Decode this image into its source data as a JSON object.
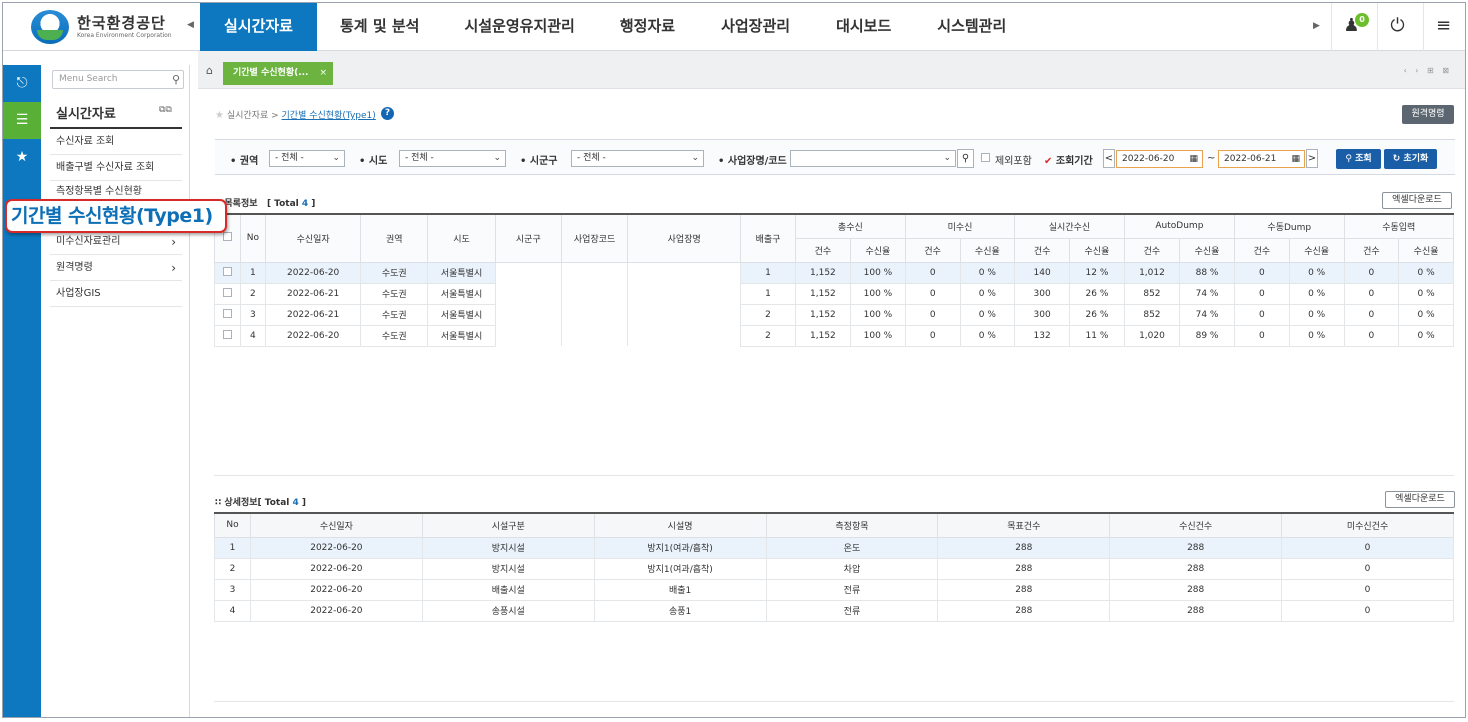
{
  "logo": {
    "title": "한국환경공단",
    "subtitle": "Korea Environment Corporation"
  },
  "gnb": [
    "실시간자료",
    "통계 및 분석",
    "시설운영유지관리",
    "행정자료",
    "사업장관리",
    "대시보드",
    "시스템관리"
  ],
  "topbar": {
    "badge": "0"
  },
  "left_icons": [
    "back-icon",
    "list-icon",
    "star-icon"
  ],
  "menu": {
    "search_placeholder": "Menu Search",
    "title": "실시간자료",
    "items": [
      "수신자료 조회",
      "배출구별 수신자료 조회",
      "측정항목별 수신현황",
      "",
      "미수신자료관리",
      "원격명령",
      "사업장GIS"
    ]
  },
  "callout": "기간별 수신현황(Type1)",
  "tab": {
    "label": "기간별 수신현황(...",
    "close": "×"
  },
  "breadcrumb": {
    "root": "실시간자료 >",
    "current": "기간별 수신현황(Type1)"
  },
  "remote_button": "원격명령",
  "filters": {
    "region_label": "권역",
    "region_value": "- 전체 -",
    "sido_label": "시도",
    "sido_value": "- 전체 -",
    "sigungu_label": "시군구",
    "sigungu_value": "- 전체 -",
    "site_label": "사업장명/코드",
    "site_value": "",
    "exclude_label": "제외포함",
    "period_label": "조회기간",
    "date_from": "2022-06-20",
    "date_sep": "~",
    "date_to": "2022-06-21",
    "search_btn": "조회",
    "reset_btn": "초기화"
  },
  "list": {
    "title": "목록정보",
    "total_label": "[ Total ",
    "total": "4",
    "total_end": " ]",
    "excel": "엑셀다운로드",
    "headers": [
      "No",
      "수신일자",
      "권역",
      "시도",
      "시군구",
      "사업장코드",
      "사업장명",
      "배출구"
    ],
    "group_headers": [
      "총수신",
      "미수신",
      "실시간수신",
      "AutoDump",
      "수동Dump",
      "수동입력"
    ],
    "sub_headers": [
      "건수",
      "수신율"
    ],
    "rows": [
      [
        "1",
        "2022-06-20",
        "수도권",
        "서울특별시",
        "",
        "",
        "",
        "1",
        "1,152",
        "100 %",
        "0",
        "0 %",
        "140",
        "12 %",
        "1,012",
        "88 %",
        "0",
        "0 %",
        "0",
        "0 %"
      ],
      [
        "2",
        "2022-06-21",
        "수도권",
        "서울특별시",
        "",
        "",
        "",
        "1",
        "1,152",
        "100 %",
        "0",
        "0 %",
        "300",
        "26 %",
        "852",
        "74 %",
        "0",
        "0 %",
        "0",
        "0 %"
      ],
      [
        "3",
        "2022-06-21",
        "수도권",
        "서울특별시",
        "",
        "",
        "",
        "2",
        "1,152",
        "100 %",
        "0",
        "0 %",
        "300",
        "26 %",
        "852",
        "74 %",
        "0",
        "0 %",
        "0",
        "0 %"
      ],
      [
        "4",
        "2022-06-20",
        "수도권",
        "서울특별시",
        "",
        "",
        "",
        "2",
        "1,152",
        "100 %",
        "0",
        "0 %",
        "132",
        "11 %",
        "1,020",
        "89 %",
        "0",
        "0 %",
        "0",
        "0 %"
      ]
    ]
  },
  "detail": {
    "title": "상세정보",
    "total_label": "[ Total ",
    "total": "4",
    "total_end": " ]",
    "excel": "엑셀다운로드",
    "headers": [
      "No",
      "수신일자",
      "시설구분",
      "시설명",
      "측정항목",
      "목표건수",
      "수신건수",
      "미수신건수"
    ],
    "rows": [
      [
        "1",
        "2022-06-20",
        "방지시설",
        "방지1(여과/흡착)",
        "온도",
        "288",
        "288",
        "0"
      ],
      [
        "2",
        "2022-06-20",
        "방지시설",
        "방지1(여과/흡착)",
        "차압",
        "288",
        "288",
        "0"
      ],
      [
        "3",
        "2022-06-20",
        "배출시설",
        "배출1",
        "전류",
        "288",
        "288",
        "0"
      ],
      [
        "4",
        "2022-06-20",
        "송풍시설",
        "송풍1",
        "전류",
        "288",
        "288",
        "0"
      ]
    ]
  }
}
